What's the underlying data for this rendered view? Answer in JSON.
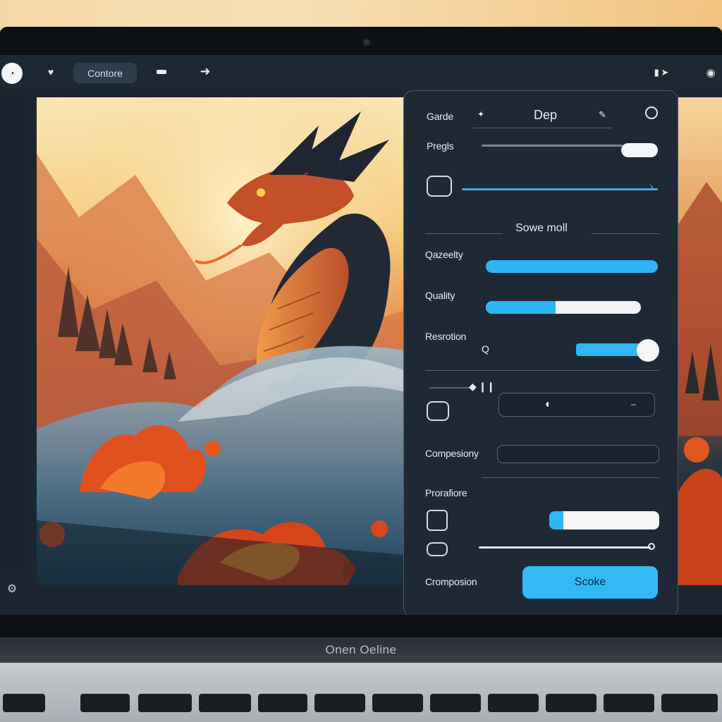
{
  "toolbar": {
    "clock_icon": "clock-icon",
    "heart_icon": "heart-icon",
    "tab_label": "Contore",
    "minus_icon": "minus-icon",
    "arrow_icon": "arrow-right-icon",
    "right_tools_icon": "device-cursor-icon",
    "far_tool_icon": "eye-icon"
  },
  "panel": {
    "row1": {
      "label": "Garde",
      "value": "Dep"
    },
    "row2": {
      "label": "Pregls"
    },
    "section": "Sowe moll",
    "rows": [
      {
        "label": "Qazeelty",
        "level": 1.0
      },
      {
        "label": "Quality",
        "level": 0.45
      },
      {
        "label": "Resrotion",
        "suffix": "Q",
        "toggle_level": 0.9
      }
    ],
    "compressy_label": "Compesiony",
    "preratore_label": "Prorafiore",
    "compression_label": "Cromposion",
    "primary_button": "Scoke",
    "accent": "#2fb6f4"
  },
  "chin_label": "Onen Oeline"
}
